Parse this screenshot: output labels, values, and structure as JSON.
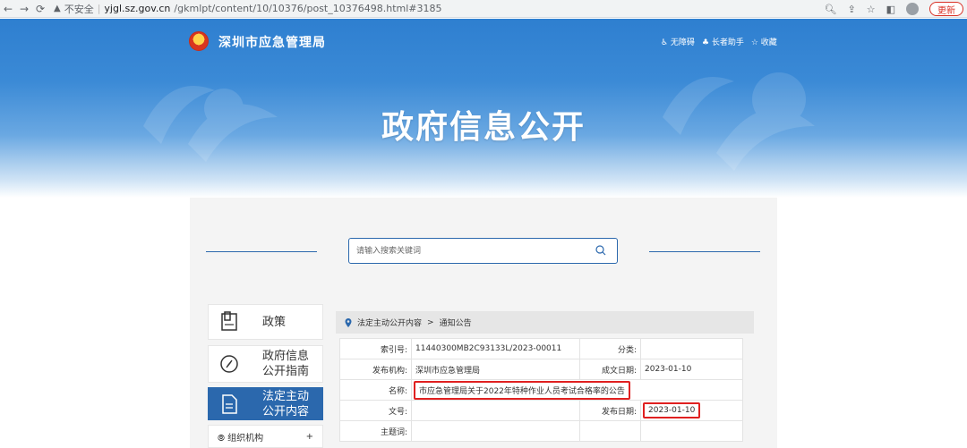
{
  "browser": {
    "back_icon": "back-arrow-icon",
    "forward_icon": "forward-arrow-icon",
    "reload_icon": "reload-icon",
    "security_label": "不安全",
    "url_domain": "yjgl.sz.gov.cn",
    "url_path": "/gkmlpt/content/10/10376/post_10376498.html#3185",
    "update_label": "更新"
  },
  "header": {
    "org_name": "深圳市应急管理局",
    "accessibility_link": "♿ 无障碍",
    "elder_link": "♣ 长者助手",
    "favorite_link": "☆ 收藏",
    "title": "政府信息公开"
  },
  "search": {
    "placeholder": "请输入搜索关键词"
  },
  "sidebar": {
    "items": [
      {
        "label_1": "政策",
        "label_2": "",
        "icon": "policy-book-icon",
        "active": false
      },
      {
        "label_1": "政府信息",
        "label_2": "公开指南",
        "icon": "compass-icon",
        "active": false
      },
      {
        "label_1": "法定主动",
        "label_2": "公开内容",
        "icon": "document-icon",
        "active": true
      }
    ],
    "sub_item": {
      "label": "⦾ 组织机构",
      "toggle": "+"
    }
  },
  "breadcrumb": {
    "items": [
      "法定主动公开内容",
      "通知公告"
    ],
    "separator": ">"
  },
  "info": {
    "rows": [
      {
        "k1": "索引号:",
        "v1": "11440300MB2C93133L/2023-00011",
        "k2": "分类:",
        "v2": ""
      },
      {
        "k1": "发布机构:",
        "v1": "深圳市应急管理局",
        "k2": "成文日期:",
        "v2": "2023-01-10"
      },
      {
        "k1": "名称:",
        "v1": "市应急管理局关于2022年特种作业人员考试合格率的公告"
      },
      {
        "k1": "文号:",
        "v1": "",
        "k2": "发布日期:",
        "v2": "2023-01-10"
      },
      {
        "k1": "主题词:",
        "v1": "",
        "k2": "",
        "v2": ""
      }
    ]
  },
  "colors": {
    "brand_blue": "#2b68ad",
    "highlight_red": "#e02020"
  }
}
